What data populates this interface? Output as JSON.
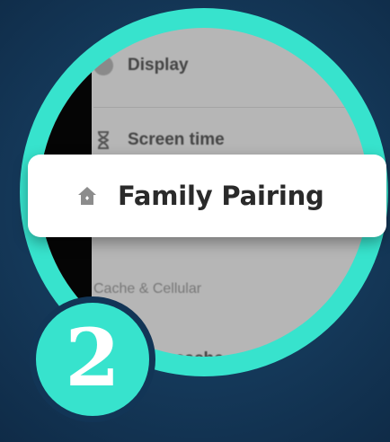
{
  "menu": {
    "display_label": "Display",
    "screen_time_label": "Screen time",
    "family_pairing_label": "Family Pairing",
    "cache_section_header": "Cache & Cellular",
    "clear_cache_label": "Clear cache"
  },
  "step": {
    "number": "2"
  },
  "colors": {
    "accent": "#37e3cd",
    "background": "#163c5e",
    "panel": "#b6b6b6",
    "card": "#ffffff"
  },
  "icons": {
    "display": "display-icon",
    "screen_time": "hourglass-icon",
    "family_pairing": "house-icon"
  }
}
